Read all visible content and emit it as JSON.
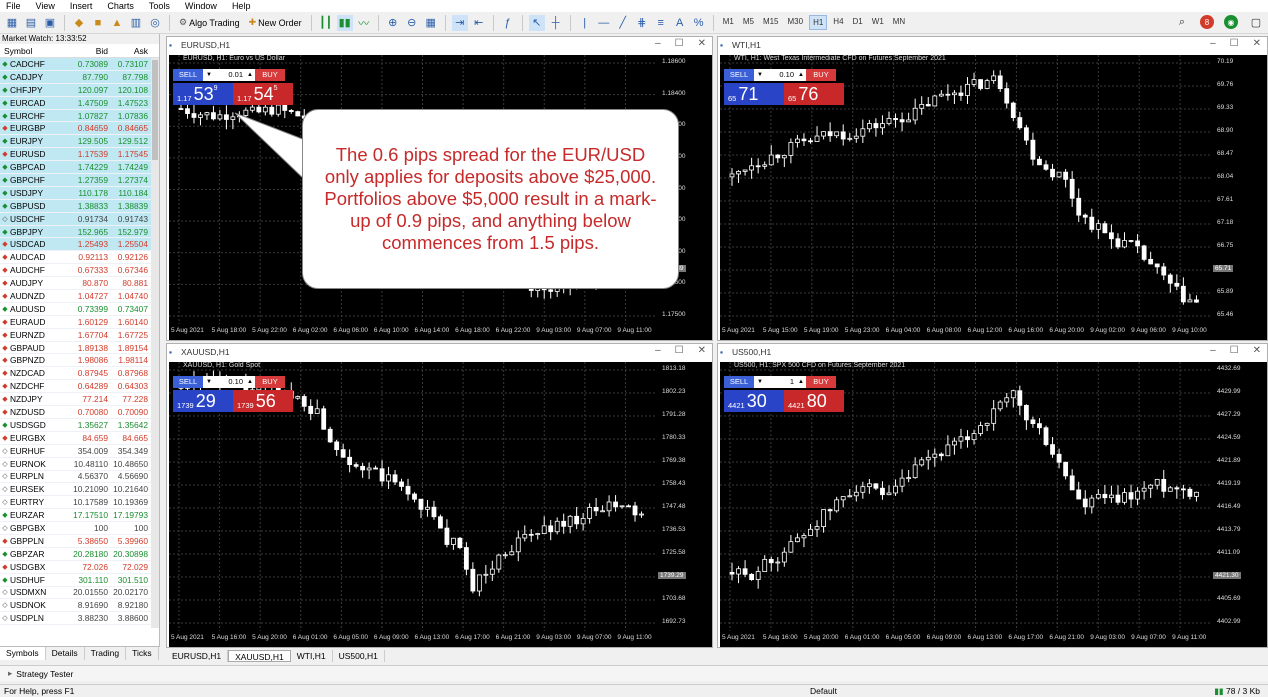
{
  "menu": [
    "File",
    "View",
    "Insert",
    "Charts",
    "Tools",
    "Window",
    "Help"
  ],
  "toolbar": {
    "algo": "Algo Trading",
    "neworder": "New Order",
    "timeframes": [
      "M1",
      "M5",
      "M15",
      "M30",
      "H1",
      "H4",
      "D1",
      "W1",
      "MN"
    ],
    "active_tf": "H1",
    "badge": "8"
  },
  "watch": {
    "title": "Market Watch: 13:33:52",
    "headers": [
      "Symbol",
      "Bid",
      "Ask"
    ],
    "rows": [
      [
        "CADCHF",
        "0.73089",
        "0.73107",
        "up",
        "hi"
      ],
      [
        "CADJPY",
        "87.790",
        "87.798",
        "up",
        "hi"
      ],
      [
        "CHFJPY",
        "120.097",
        "120.108",
        "up",
        "hi"
      ],
      [
        "EURCAD",
        "1.47509",
        "1.47523",
        "up",
        "hi"
      ],
      [
        "EURCHF",
        "1.07827",
        "1.07836",
        "up",
        "hi"
      ],
      [
        "EURGBP",
        "0.84659",
        "0.84665",
        "dn",
        "hi"
      ],
      [
        "EURJPY",
        "129.505",
        "129.512",
        "up",
        "hi"
      ],
      [
        "EURUSD",
        "1.17539",
        "1.17545",
        "dn",
        "hi"
      ],
      [
        "GBPCAD",
        "1.74229",
        "1.74249",
        "up",
        "hi"
      ],
      [
        "GBPCHF",
        "1.27359",
        "1.27374",
        "up",
        "hi"
      ],
      [
        "USDJPY",
        "110.178",
        "110.184",
        "up",
        "hi"
      ],
      [
        "GBPUSD",
        "1.38833",
        "1.38839",
        "up",
        "hi"
      ],
      [
        "USDCHF",
        "0.91734",
        "0.91743",
        "nt",
        "hi"
      ],
      [
        "GBPJPY",
        "152.965",
        "152.979",
        "up",
        "hi"
      ],
      [
        "USDCAD",
        "1.25493",
        "1.25504",
        "dn",
        "hi"
      ],
      [
        "AUDCAD",
        "0.92113",
        "0.92126",
        "dn",
        "lo"
      ],
      [
        "AUDCHF",
        "0.67333",
        "0.67346",
        "dn",
        "lo"
      ],
      [
        "AUDJPY",
        "80.870",
        "80.881",
        "dn",
        "lo"
      ],
      [
        "AUDNZD",
        "1.04727",
        "1.04740",
        "dn",
        "lo"
      ],
      [
        "AUDUSD",
        "0.73399",
        "0.73407",
        "up",
        "lo"
      ],
      [
        "EURAUD",
        "1.60129",
        "1.60140",
        "dn",
        "lo"
      ],
      [
        "EURNZD",
        "1.67704",
        "1.67725",
        "dn",
        "lo"
      ],
      [
        "GBPAUD",
        "1.89138",
        "1.89154",
        "dn",
        "lo"
      ],
      [
        "GBPNZD",
        "1.98086",
        "1.98114",
        "dn",
        "lo"
      ],
      [
        "NZDCAD",
        "0.87945",
        "0.87968",
        "dn",
        "lo"
      ],
      [
        "NZDCHF",
        "0.64289",
        "0.64303",
        "dn",
        "lo"
      ],
      [
        "NZDJPY",
        "77.214",
        "77.228",
        "dn",
        "lo"
      ],
      [
        "NZDUSD",
        "0.70080",
        "0.70090",
        "dn",
        "lo"
      ],
      [
        "USDSGD",
        "1.35627",
        "1.35642",
        "up",
        "lo"
      ],
      [
        "EURGBX",
        "84.659",
        "84.665",
        "dn",
        "lo"
      ],
      [
        "EURHUF",
        "354.009",
        "354.349",
        "nt",
        "lo"
      ],
      [
        "EURNOK",
        "10.48110",
        "10.48650",
        "nt",
        "lo"
      ],
      [
        "EURPLN",
        "4.56370",
        "4.56690",
        "nt",
        "lo"
      ],
      [
        "EURSEK",
        "10.21090",
        "10.21640",
        "nt",
        "lo"
      ],
      [
        "EURTRY",
        "10.17589",
        "10.19369",
        "nt",
        "lo"
      ],
      [
        "EURZAR",
        "17.17510",
        "17.19793",
        "up",
        "lo"
      ],
      [
        "GBPGBX",
        "100",
        "100",
        "nt",
        "lo"
      ],
      [
        "GBPPLN",
        "5.38650",
        "5.39960",
        "dn",
        "lo"
      ],
      [
        "GBPZAR",
        "20.28180",
        "20.30898",
        "up",
        "lo"
      ],
      [
        "USDGBX",
        "72.026",
        "72.029",
        "dn",
        "lo"
      ],
      [
        "USDHUF",
        "301.110",
        "301.510",
        "up",
        "lo"
      ],
      [
        "USDMXN",
        "20.01550",
        "20.02170",
        "nt",
        "lo"
      ],
      [
        "USDNOK",
        "8.91690",
        "8.92180",
        "nt",
        "lo"
      ],
      [
        "USDPLN",
        "3.88230",
        "3.88600",
        "nt",
        "lo"
      ]
    ],
    "tabs": [
      "Symbols",
      "Details",
      "Trading",
      "Ticks"
    ]
  },
  "charts": [
    {
      "title": "EURUSD,H1",
      "head": "EURUSD, H1:  Euro vs US Dollar",
      "lot": "0.01",
      "sell_pre": "1.17",
      "sell_big": "53",
      "sell_sup": "9",
      "buy_pre": "1.17",
      "buy_big": "54",
      "buy_sup": "5",
      "prices": [
        "1.18600",
        "1.18400",
        "1.18300",
        "1.18200",
        "1.18000",
        "1.17900",
        "1.17800",
        "1.17600",
        "1.17500"
      ],
      "current": "1.17539",
      "times": [
        "5 Aug 2021",
        "5 Aug 18:00",
        "5 Aug 22:00",
        "6 Aug 02:00",
        "6 Aug 06:00",
        "6 Aug 10:00",
        "6 Aug 14:00",
        "6 Aug 18:00",
        "6 Aug 22:00",
        "9 Aug 03:00",
        "9 Aug 07:00",
        "9 Aug 11:00"
      ]
    },
    {
      "title": "WTI,H1",
      "head": "WTI, H1:  West Texas Intermediate CFD on Futures September 2021",
      "lot": "0.10",
      "sell_pre": "65",
      "sell_big": "71",
      "sell_sup": "",
      "buy_pre": "65",
      "buy_big": "76",
      "buy_sup": "",
      "prices": [
        "70.19",
        "69.76",
        "69.33",
        "68.90",
        "68.47",
        "68.04",
        "67.61",
        "67.18",
        "66.75",
        "66.32",
        "65.89",
        "65.46"
      ],
      "current": "65.71",
      "times": [
        "5 Aug 2021",
        "5 Aug 15:00",
        "5 Aug 19:00",
        "5 Aug 23:00",
        "6 Aug 04:00",
        "6 Aug 08:00",
        "6 Aug 12:00",
        "6 Aug 16:00",
        "6 Aug 20:00",
        "9 Aug 02:00",
        "9 Aug 06:00",
        "9 Aug 10:00"
      ]
    },
    {
      "title": "XAUUSD,H1",
      "head": "XAUUSD, H1:  Gold Spot",
      "lot": "0.10",
      "sell_pre": "1739",
      "sell_big": "29",
      "sell_sup": "",
      "buy_pre": "1739",
      "buy_big": "56",
      "buy_sup": "",
      "prices": [
        "1813.18",
        "1802.23",
        "1791.28",
        "1780.33",
        "1769.38",
        "1758.43",
        "1747.48",
        "1736.53",
        "1725.58",
        "1714.63",
        "1703.68",
        "1692.73"
      ],
      "current": "1739.29",
      "times": [
        "5 Aug 2021",
        "5 Aug 16:00",
        "5 Aug 20:00",
        "6 Aug 01:00",
        "6 Aug 05:00",
        "6 Aug 09:00",
        "6 Aug 13:00",
        "6 Aug 17:00",
        "6 Aug 21:00",
        "9 Aug 03:00",
        "9 Aug 07:00",
        "9 Aug 11:00"
      ]
    },
    {
      "title": "US500,H1",
      "head": "US500, H1:  SPX 500 CFD on Futures September 2021",
      "lot": "1",
      "sell_pre": "4421",
      "sell_big": "30",
      "sell_sup": "",
      "buy_pre": "4421",
      "buy_big": "80",
      "buy_sup": "",
      "prices": [
        "4432.69",
        "4429.99",
        "4427.29",
        "4424.59",
        "4421.89",
        "4419.19",
        "4416.49",
        "4413.79",
        "4411.09",
        "4408.39",
        "4405.69",
        "4402.99"
      ],
      "current": "4421.30",
      "times": [
        "5 Aug 2021",
        "5 Aug 16:00",
        "5 Aug 20:00",
        "6 Aug 01:00",
        "6 Aug 05:00",
        "6 Aug 09:00",
        "6 Aug 13:00",
        "6 Aug 17:00",
        "6 Aug 21:00",
        "9 Aug 03:00",
        "9 Aug 07:00",
        "9 Aug 11:00"
      ]
    }
  ],
  "callout": "The 0.6 pips spread for the EUR/USD only applies for deposits above $25,000.  Portfolios above $5,000 result in a mark-up of 0.9 pips, and anything below commences from 1.5 pips.",
  "chart_tabs": [
    "EURUSD,H1",
    "XAUUSD,H1",
    "WTI,H1",
    "US500,H1"
  ],
  "active_chart_tab": "XAUUSD,H1",
  "strategy": "Strategy Tester",
  "status": {
    "help": "For Help, press F1",
    "profile": "Default",
    "traffic": "78 / 3 Kb"
  }
}
